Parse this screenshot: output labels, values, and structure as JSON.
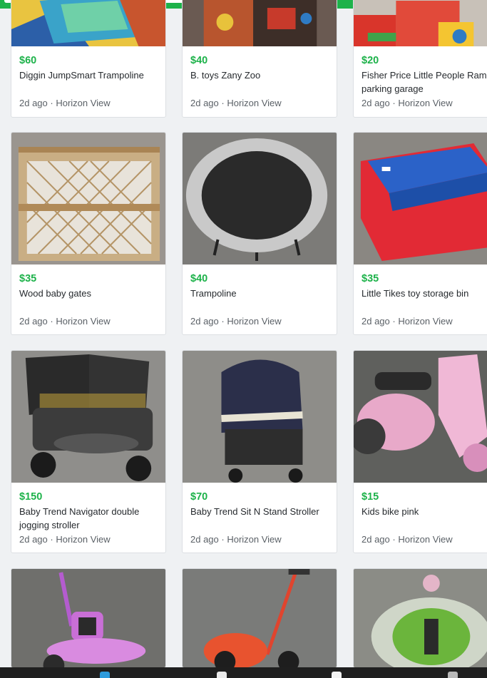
{
  "colors": {
    "accent": "#1db24a",
    "text": "#262a2e",
    "muted": "#5b6167"
  },
  "listings": [
    {
      "price": "$60",
      "title": "Diggin JumpSmart Trampoline",
      "age": "2d ago",
      "location": "Horizon View",
      "image_icon": "trampoline-mat-photo"
    },
    {
      "price": "$40",
      "title": "B. toys Zany Zoo",
      "age": "2d ago",
      "location": "Horizon View",
      "image_icon": "activity-cube-photo"
    },
    {
      "price": "$20",
      "title": "Fisher Price Little People Ramps parking garage",
      "age": "2d ago",
      "location": "Horizon View",
      "image_icon": "parking-garage-toy-photo"
    },
    {
      "price": "$35",
      "title": "Wood baby gates",
      "age": "2d ago",
      "location": "Horizon View",
      "image_icon": "baby-gate-photo"
    },
    {
      "price": "$40",
      "title": "Trampoline",
      "age": "2d ago",
      "location": "Horizon View",
      "image_icon": "mini-trampoline-photo"
    },
    {
      "price": "$35",
      "title": "Little Tikes toy storage bin",
      "age": "2d ago",
      "location": "Horizon View",
      "image_icon": "storage-bin-photo"
    },
    {
      "price": "$150",
      "title": "Baby Trend Navigator double jogging stroller",
      "age": "2d ago",
      "location": "Horizon View",
      "image_icon": "double-stroller-photo"
    },
    {
      "price": "$70",
      "title": "Baby Trend Sit N Stand Stroller",
      "age": "2d ago",
      "location": "Horizon View",
      "image_icon": "stroller-photo"
    },
    {
      "price": "$15",
      "title": "Kids bike pink",
      "age": "2d ago",
      "location": "Horizon View",
      "image_icon": "pink-bike-photo"
    },
    {
      "image_icon": "purple-tricycle-photo"
    },
    {
      "image_icon": "red-tricycle-photo"
    },
    {
      "image_icon": "baby-swing-photo"
    }
  ],
  "meta_separator": " · "
}
